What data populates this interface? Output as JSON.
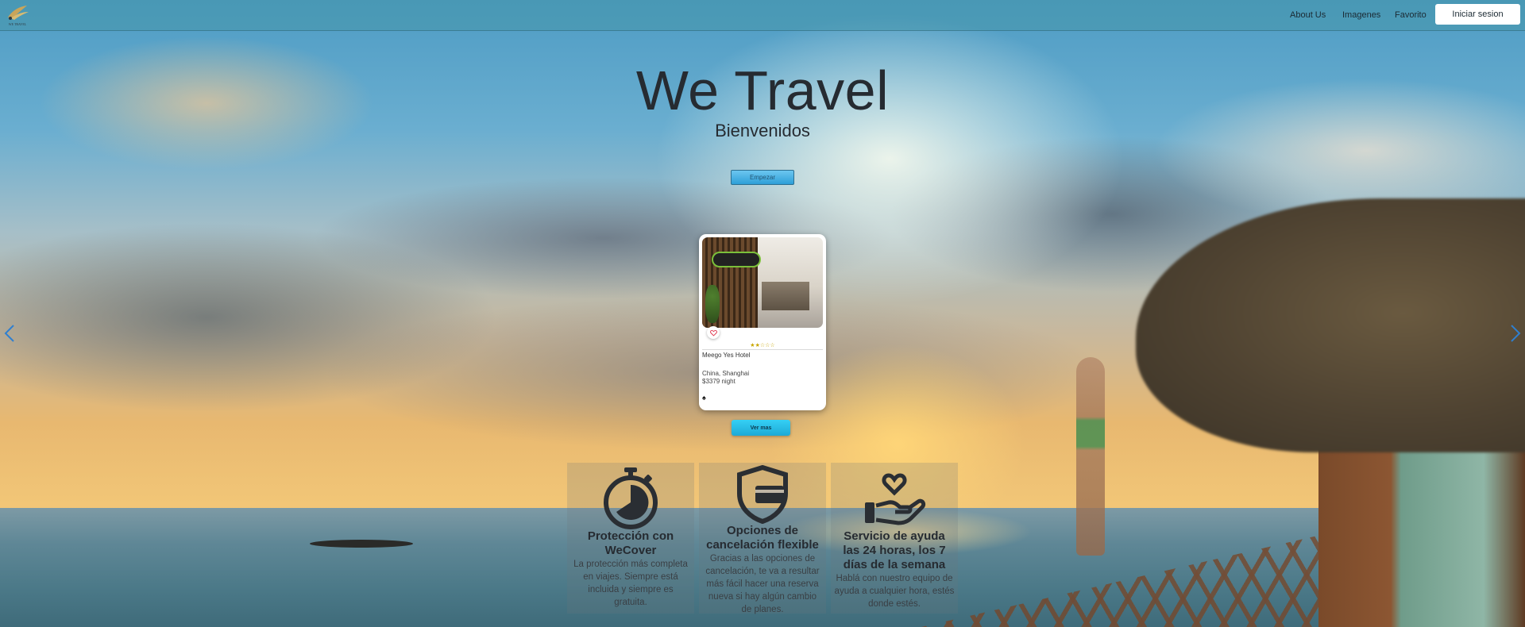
{
  "brand": {
    "logo_text": "WE TRAVEL"
  },
  "nav": {
    "links": [
      "About Us",
      "Imagenes",
      "Favorito"
    ],
    "login_label": "Iniciar sesion"
  },
  "hero": {
    "title": "We Travel",
    "subtitle": "Bienvenidos",
    "start_label": "Empezar"
  },
  "carousel": {
    "prev_icon": "chevron-left-icon",
    "next_icon": "chevron-right-icon"
  },
  "hotel_card": {
    "name": "Meego Yes Hotel",
    "stars": "★★☆☆☆",
    "rating": 2,
    "location": "China, Shanghai",
    "price": "$3379 night",
    "favorite_icon": "heart-icon",
    "tag_icon": "spade-icon"
  },
  "more_label": "Ver mas",
  "features": [
    {
      "icon": "stopwatch-icon",
      "title": "Protección con WeCover",
      "text": "La protección más completa en viajes. Siempre está incluida y siempre es gratuita."
    },
    {
      "icon": "shield-card-icon",
      "title": "Opciones de cancelación flexible",
      "text": "Gracias a las opciones de cancelación, te va a resultar más fácil hacer una reserva nueva si hay algún cambio de planes."
    },
    {
      "icon": "helping-hand-heart-icon",
      "title": "Servicio de ayuda las 24 horas, los 7 días de la semana",
      "text": "Hablá con nuestro equipo de ayuda a cualquier hora, estés donde estés."
    }
  ],
  "colors": {
    "accent": "#2d9fd8",
    "more_button": "#1da9d6",
    "title_text": "#262b31"
  }
}
